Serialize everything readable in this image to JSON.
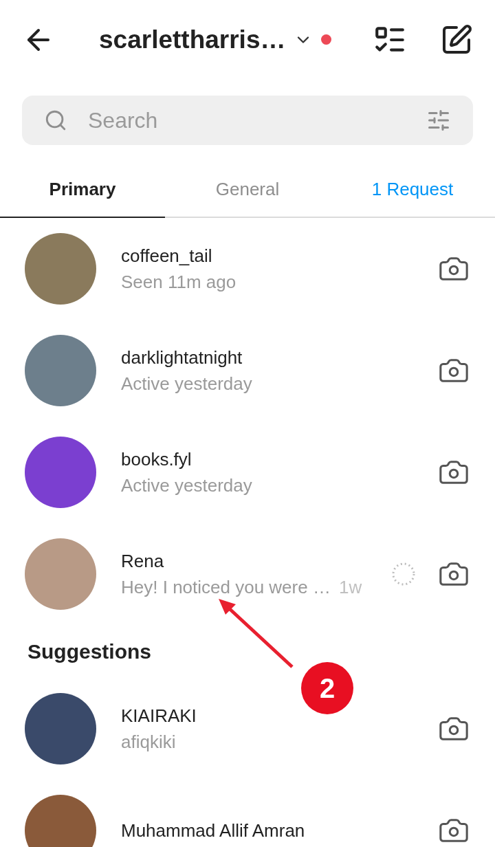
{
  "header": {
    "username": "scarlettharris…",
    "notification_dot": true
  },
  "search": {
    "placeholder": "Search"
  },
  "tabs": [
    {
      "label": "Primary",
      "selected": true,
      "kind": "normal"
    },
    {
      "label": "General",
      "selected": false,
      "kind": "normal"
    },
    {
      "label": "1 Request",
      "selected": false,
      "kind": "request"
    }
  ],
  "chats": [
    {
      "name": "coffeen_tail",
      "subtitle": "Seen 11m ago"
    },
    {
      "name": "darklightatnight",
      "subtitle": "Active yesterday"
    },
    {
      "name": "books.fyl",
      "subtitle": "Active yesterday"
    },
    {
      "name": "Rena",
      "subtitle": "Hey! I noticed you were …",
      "time": "1w"
    }
  ],
  "suggestions": {
    "title": "Suggestions",
    "items": [
      {
        "name": "KIAIRAKI",
        "subtitle": "afiqkiki"
      },
      {
        "name": "Muhammad Allif Amran"
      }
    ]
  },
  "annotation": {
    "number": "2"
  }
}
